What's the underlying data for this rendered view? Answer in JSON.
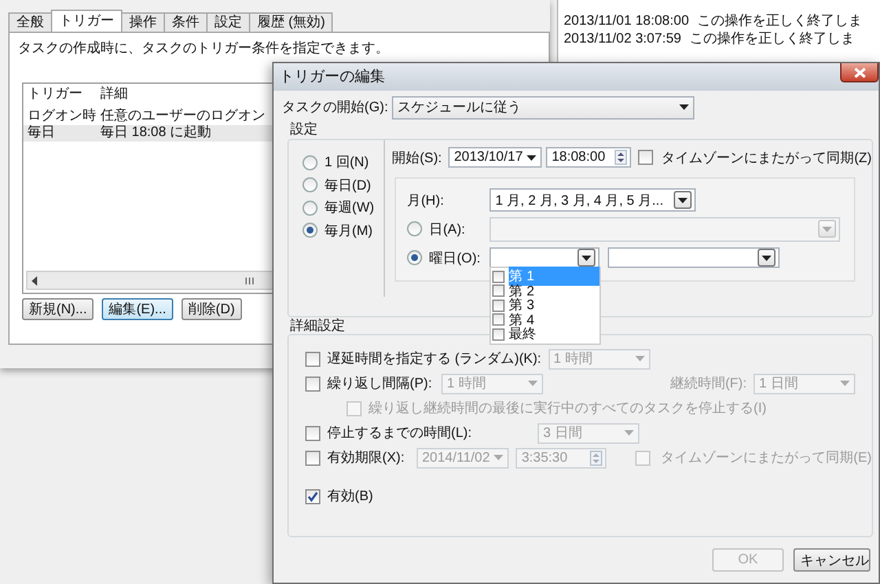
{
  "properties": {
    "tabs": [
      {
        "label": "全般",
        "selected": false
      },
      {
        "label": "トリガー",
        "selected": true
      },
      {
        "label": "操作",
        "selected": false
      },
      {
        "label": "条件",
        "selected": false
      },
      {
        "label": "設定",
        "selected": false
      },
      {
        "label": "履歴 (無効)",
        "selected": false
      }
    ],
    "description": "タスクの作成時に、タスクのトリガー条件を指定できます。",
    "trigger_table": {
      "columns": [
        "トリガー",
        "詳細"
      ],
      "rows": [
        {
          "cells": [
            "ログオン時",
            "任意のユーザーのログオン"
          ],
          "selected": false
        },
        {
          "cells": [
            "毎日",
            "毎日 18:08 に起動"
          ],
          "selected": true
        }
      ]
    },
    "buttons": [
      {
        "label": "新規(N)...",
        "focused": false
      },
      {
        "label": "編集(E)...",
        "focused": true
      },
      {
        "label": "削除(D)",
        "focused": false
      }
    ]
  },
  "history": {
    "rows": [
      {
        "date": "2013/11/01 18:08:00",
        "message": "この操作を正しく終了しま"
      },
      {
        "date": "2013/11/02 3:07:59",
        "message": "この操作を正しく終了しま"
      }
    ]
  },
  "dialog": {
    "title": "トリガーの編集",
    "task_start": {
      "label": "タスクの開始(G):",
      "value": "スケジュールに従う"
    },
    "settings": {
      "title": "設定",
      "schedules": [
        {
          "label": "1 回(N)",
          "selected": false
        },
        {
          "label": "毎日(D)",
          "selected": false
        },
        {
          "label": "毎週(W)",
          "selected": false
        },
        {
          "label": "毎月(M)",
          "selected": true
        }
      ],
      "start": {
        "label": "開始(S):",
        "date": "2013/10/17",
        "time": "18:08:00",
        "sync": {
          "label": "タイムゾーンにまたがって同期(Z)",
          "checked": false
        }
      },
      "months": {
        "label": "月(H):",
        "value": "1 月, 2 月, 3 月, 4 月, 5 月..."
      },
      "day": {
        "label": "日(A):",
        "selected": false
      },
      "weekday": {
        "label": "曜日(O):",
        "selected": true,
        "week_options": [
          {
            "label": "第 1",
            "checked": false,
            "selected": true
          },
          {
            "label": "第 2",
            "checked": false,
            "selected": false
          },
          {
            "label": "第 3",
            "checked": false,
            "selected": false
          },
          {
            "label": "第 4",
            "checked": false,
            "selected": false
          },
          {
            "label": "最終",
            "checked": false,
            "selected": false
          }
        ]
      }
    },
    "advanced": {
      "title": "詳細設定",
      "delay": {
        "label": "遅延時間を指定する (ランダム)(K):",
        "checked": false,
        "value": "1 時間"
      },
      "repeat": {
        "label": "繰り返し間隔(P):",
        "checked": false,
        "value": "1 時間",
        "duration_label": "継続時間(F):",
        "duration_value": "1 日間",
        "stop_at_end": {
          "label": "繰り返し継続時間の最後に実行中のすべてのタスクを停止する(I)",
          "checked": false
        }
      },
      "stop_after": {
        "label": "停止するまでの時間(L):",
        "checked": false,
        "value": "3 日間"
      },
      "expire": {
        "label": "有効期限(X):",
        "checked": false,
        "date": "2014/11/02",
        "time": "3:35:30",
        "sync": {
          "label": "タイムゾーンにまたがって同期(E)",
          "checked": false
        }
      },
      "enabled": {
        "label": "有効(B)",
        "checked": true
      }
    },
    "buttons": [
      {
        "label": "OK",
        "disabled": true
      },
      {
        "label": "キャンセル",
        "disabled": false
      }
    ]
  }
}
